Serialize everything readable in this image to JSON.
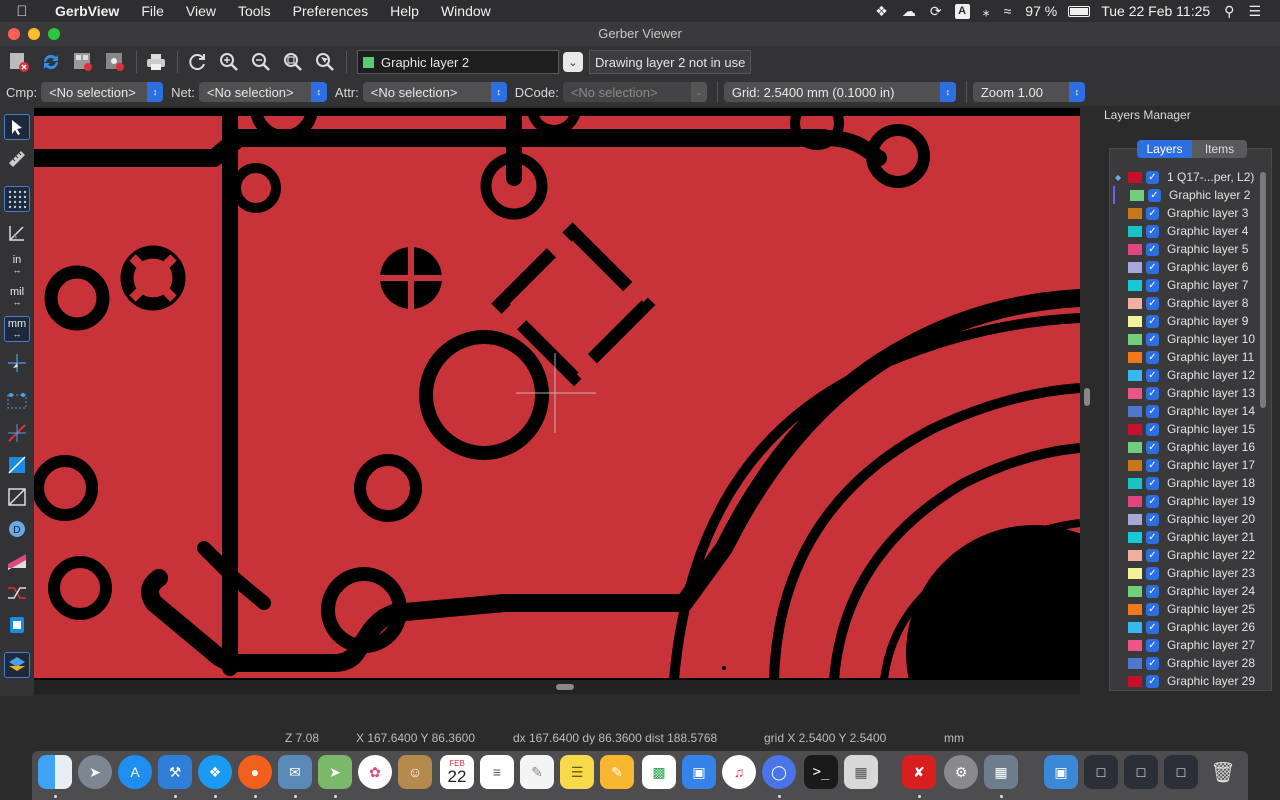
{
  "menubar": {
    "app_name": "GerbView",
    "items": [
      "File",
      "View",
      "Tools",
      "Preferences",
      "Help",
      "Window"
    ],
    "battery": "97 %",
    "datetime": "Tue 22 Feb  11:25",
    "input_badge": "A"
  },
  "window": {
    "title": "Gerber Viewer"
  },
  "toolbar": {
    "active_layer": "Graphic layer 2",
    "active_layer_color": "#5bc96e",
    "drawing_status": "Drawing layer 2 not in use"
  },
  "filterbar": {
    "cmp_label": "Cmp:",
    "cmp_value": "<No selection>",
    "net_label": "Net:",
    "net_value": "<No selection>",
    "attr_label": "Attr:",
    "attr_value": "<No selection>",
    "dcode_label": "DCode:",
    "dcode_value": "<No selection>",
    "grid_value": "Grid: 2.5400 mm (0.1000 in)",
    "zoom_value": "Zoom 1.00"
  },
  "lefttools": {
    "in_label": "in",
    "mil_label": "mil",
    "mm_label": "mm"
  },
  "layers_manager": {
    "title": "Layers Manager",
    "tab_layers": "Layers",
    "tab_items": "Items",
    "layers": [
      {
        "name": "1 Q17-...per, L2)",
        "color": "#c8102e",
        "mark": "◆"
      },
      {
        "name": "Graphic layer 2",
        "color": "#6fcf7e",
        "mark": ""
      },
      {
        "name": "Graphic layer 3",
        "color": "#c8761a",
        "mark": ""
      },
      {
        "name": "Graphic layer 4",
        "color": "#17c3c3",
        "mark": ""
      },
      {
        "name": "Graphic layer 5",
        "color": "#e0457b",
        "mark": ""
      },
      {
        "name": "Graphic layer 6",
        "color": "#a7a7d8",
        "mark": ""
      },
      {
        "name": "Graphic layer 7",
        "color": "#15c9d6",
        "mark": ""
      },
      {
        "name": "Graphic layer 8",
        "color": "#f0b0a0",
        "mark": ""
      },
      {
        "name": "Graphic layer 9",
        "color": "#f2f29a",
        "mark": ""
      },
      {
        "name": "Graphic layer 10",
        "color": "#72d07a",
        "mark": ""
      },
      {
        "name": "Graphic layer 11",
        "color": "#f07a1a",
        "mark": ""
      },
      {
        "name": "Graphic layer 12",
        "color": "#35b9f0",
        "mark": ""
      },
      {
        "name": "Graphic layer 13",
        "color": "#ee5587",
        "mark": ""
      },
      {
        "name": "Graphic layer 14",
        "color": "#4f78cc",
        "mark": ""
      },
      {
        "name": "Graphic layer 15",
        "color": "#c8102e",
        "mark": ""
      },
      {
        "name": "Graphic layer 16",
        "color": "#6fcf7e",
        "mark": ""
      },
      {
        "name": "Graphic layer 17",
        "color": "#c8761a",
        "mark": ""
      },
      {
        "name": "Graphic layer 18",
        "color": "#17c3c3",
        "mark": ""
      },
      {
        "name": "Graphic layer 19",
        "color": "#e0457b",
        "mark": ""
      },
      {
        "name": "Graphic layer 20",
        "color": "#a7a7d8",
        "mark": ""
      },
      {
        "name": "Graphic layer 21",
        "color": "#15c9d6",
        "mark": ""
      },
      {
        "name": "Graphic layer 22",
        "color": "#f0b0a0",
        "mark": ""
      },
      {
        "name": "Graphic layer 23",
        "color": "#f2f29a",
        "mark": ""
      },
      {
        "name": "Graphic layer 24",
        "color": "#72d07a",
        "mark": ""
      },
      {
        "name": "Graphic layer 25",
        "color": "#f07a1a",
        "mark": ""
      },
      {
        "name": "Graphic layer 26",
        "color": "#35b9f0",
        "mark": ""
      },
      {
        "name": "Graphic layer 27",
        "color": "#ee5587",
        "mark": ""
      },
      {
        "name": "Graphic layer 28",
        "color": "#4f78cc",
        "mark": ""
      },
      {
        "name": "Graphic layer 29",
        "color": "#c8102e",
        "mark": ""
      }
    ]
  },
  "statusbar": {
    "z": "Z 7.08",
    "xy": "X 167.6400  Y 86.3600",
    "delta": "dx 167.6400  dy 86.3600  dist 188.5768",
    "grid": "grid X 2.5400  Y 2.5400",
    "units": "mm"
  },
  "dock": {
    "calendar_month": "FEB",
    "calendar_day": "22"
  },
  "colors": {
    "board": "#c8333a",
    "copper": "#000000",
    "accent": "#2d6fe0"
  }
}
